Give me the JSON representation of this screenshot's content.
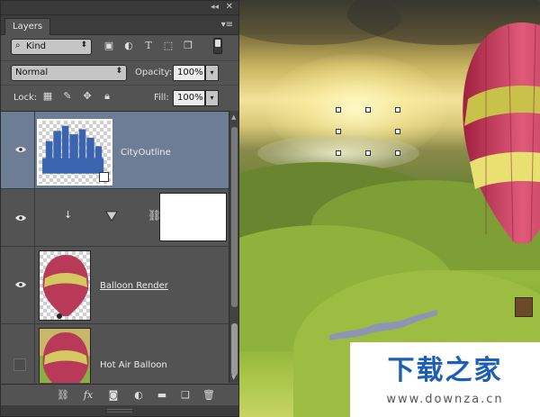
{
  "panel": {
    "tab_label": "Layers",
    "kind_filter": "Kind",
    "blend_mode": "Normal",
    "opacity_label": "Opacity:",
    "opacity_value": "100%",
    "lock_label": "Lock:",
    "fill_label": "Fill:",
    "fill_value": "100%"
  },
  "layers": [
    {
      "name": "CityOutline",
      "visible": true,
      "selected": true,
      "type": "smart-object"
    },
    {
      "name": "",
      "visible": true,
      "selected": false,
      "type": "adjustment-clipped"
    },
    {
      "name": "Balloon Render",
      "visible": true,
      "selected": false,
      "type": "pixel"
    },
    {
      "name": "Hot Air Balloon",
      "visible": false,
      "selected": false,
      "type": "pixel"
    }
  ],
  "watermark": {
    "title": "下载之家",
    "url": "www.downza.cn"
  },
  "colors": {
    "panel_bg": "#535353",
    "selected_layer": "#6e7d96",
    "watermark_blue": "#1d5fb8"
  }
}
